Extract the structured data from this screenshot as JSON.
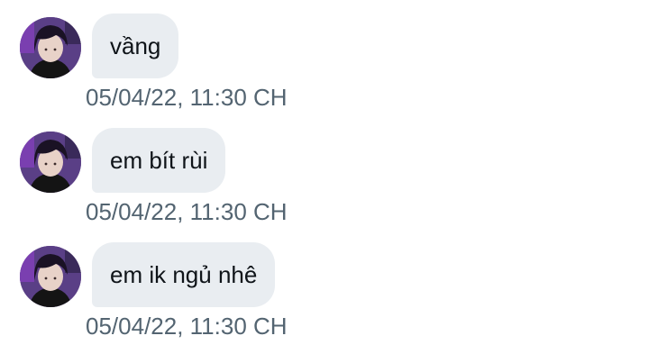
{
  "messages": [
    {
      "text": "vầng",
      "timestamp": "05/04/22, 11:30 CH",
      "avatar_icon": "user-avatar-icon"
    },
    {
      "text": "em bít rùi",
      "timestamp": "05/04/22, 11:30 CH",
      "avatar_icon": "user-avatar-icon"
    },
    {
      "text": "em ik ngủ nhê",
      "timestamp": "05/04/22, 11:30 CH",
      "avatar_icon": "user-avatar-icon"
    }
  ],
  "colors": {
    "bubble_background": "#e9edf1",
    "message_text": "#0f1419",
    "timestamp_text": "#536471",
    "page_background": "#ffffff"
  }
}
